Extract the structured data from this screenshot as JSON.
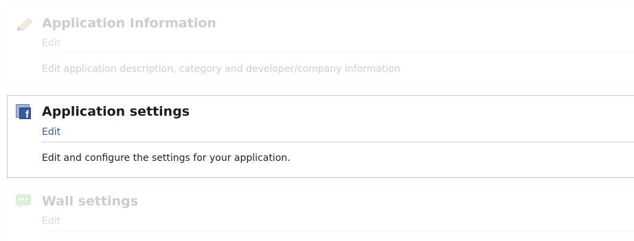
{
  "sections": [
    {
      "title": "Application Information",
      "edit_label": "Edit",
      "description": "Edit application description, category and developer/company information",
      "icon": "pencil-icon",
      "state": "dimmed"
    },
    {
      "title": "Application settings",
      "edit_label": "Edit",
      "description": "Edit and configure the settings for your application.",
      "icon": "facebook-app-icon",
      "state": "active"
    },
    {
      "title": "Wall settings",
      "edit_label": "Edit",
      "icon": "speech-bubble-icon",
      "state": "dimmed"
    }
  ],
  "colors": {
    "link": "#3b5998",
    "title": "#1c1c1c",
    "border_active": "#c9c9c9"
  }
}
